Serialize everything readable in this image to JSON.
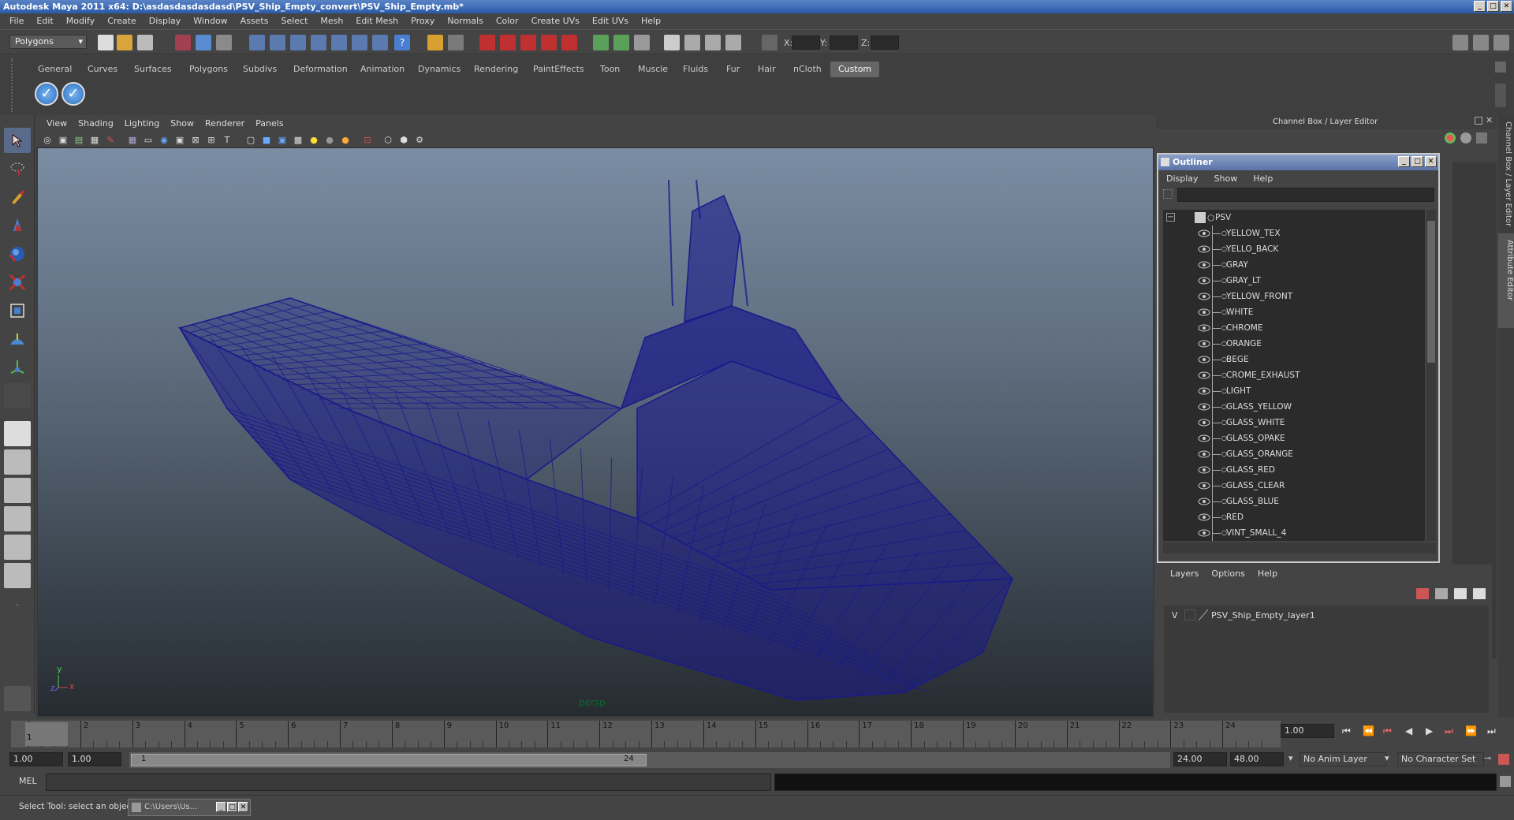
{
  "window": {
    "title": "Autodesk Maya 2011 x64: D:\\asdasdasdasdasd\\PSV_Ship_Empty_convert\\PSV_Ship_Empty.mb*",
    "min_glyph": "_",
    "max_glyph": "□",
    "close_glyph": "✕"
  },
  "menubar": [
    "File",
    "Edit",
    "Modify",
    "Create",
    "Display",
    "Window",
    "Assets",
    "Select",
    "Mesh",
    "Edit Mesh",
    "Proxy",
    "Normals",
    "Color",
    "Create UVs",
    "Edit UVs",
    "Help"
  ],
  "statusline": {
    "mode": "Polygons",
    "x_label": "X:",
    "y_label": "Y:",
    "z_label": "Z:"
  },
  "shelf": {
    "tabs": [
      "General",
      "Curves",
      "Surfaces",
      "Polygons",
      "Subdivs",
      "Deformation",
      "Animation",
      "Dynamics",
      "Rendering",
      "PaintEffects",
      "Toon",
      "Muscle",
      "Fluids",
      "Fur",
      "Hair",
      "nCloth",
      "Custom"
    ],
    "active_tab": "Custom"
  },
  "viewport": {
    "menu": [
      "View",
      "Shading",
      "Lighting",
      "Show",
      "Renderer",
      "Panels"
    ],
    "camera_label": "persp",
    "axis_y": "y",
    "axis_x": "x",
    "axis_z": "z",
    "wire_color": "#1a1a8a"
  },
  "channel_box": {
    "title": "Channel Box / Layer Editor"
  },
  "side_tabs": [
    "Channel Box / Layer Editor",
    "Attribute Editor"
  ],
  "outliner": {
    "title": "Outliner",
    "menu": [
      "Display",
      "Show",
      "Help"
    ],
    "root": "PSV",
    "items": [
      "YELLOW_TEX",
      "YELLO_BACK",
      "GRAY",
      "GRAY_LT",
      "YELLOW_FRONT",
      "WHITE",
      "CHROME",
      "ORANGE",
      "BEGE",
      "CROME_EXHAUST",
      "LIGHT",
      "GLASS_YELLOW",
      "GLASS_WHITE",
      "GLASS_OPAKE",
      "GLASS_ORANGE",
      "GLASS_RED",
      "GLASS_CLEAR",
      "GLASS_BLUE",
      "RED",
      "VINT_SMALL_4"
    ]
  },
  "layers": {
    "menu": [
      "Layers",
      "Options",
      "Help"
    ],
    "layer_visible": "V",
    "layer_name": "PSV_Ship_Empty_layer1"
  },
  "timeline": {
    "ticks": [
      "1",
      "2",
      "3",
      "4",
      "5",
      "6",
      "7",
      "8",
      "9",
      "10",
      "11",
      "12",
      "13",
      "14",
      "15",
      "16",
      "17",
      "18",
      "19",
      "20",
      "21",
      "22",
      "23",
      "24"
    ],
    "current_frame_marker": "1",
    "current_time": "1.00"
  },
  "range": {
    "start_time": "1.00",
    "playback_start": "1.00",
    "slider_left": "1",
    "slider_right": "24",
    "playback_end": "24.00",
    "end_time": "48.00",
    "anim_layer": "No Anim Layer",
    "character_set": "No Character Set"
  },
  "command": {
    "label": "MEL"
  },
  "help": {
    "text": "Select Tool: select an object",
    "taskbar_item": "C:\\Users\\Us..."
  }
}
